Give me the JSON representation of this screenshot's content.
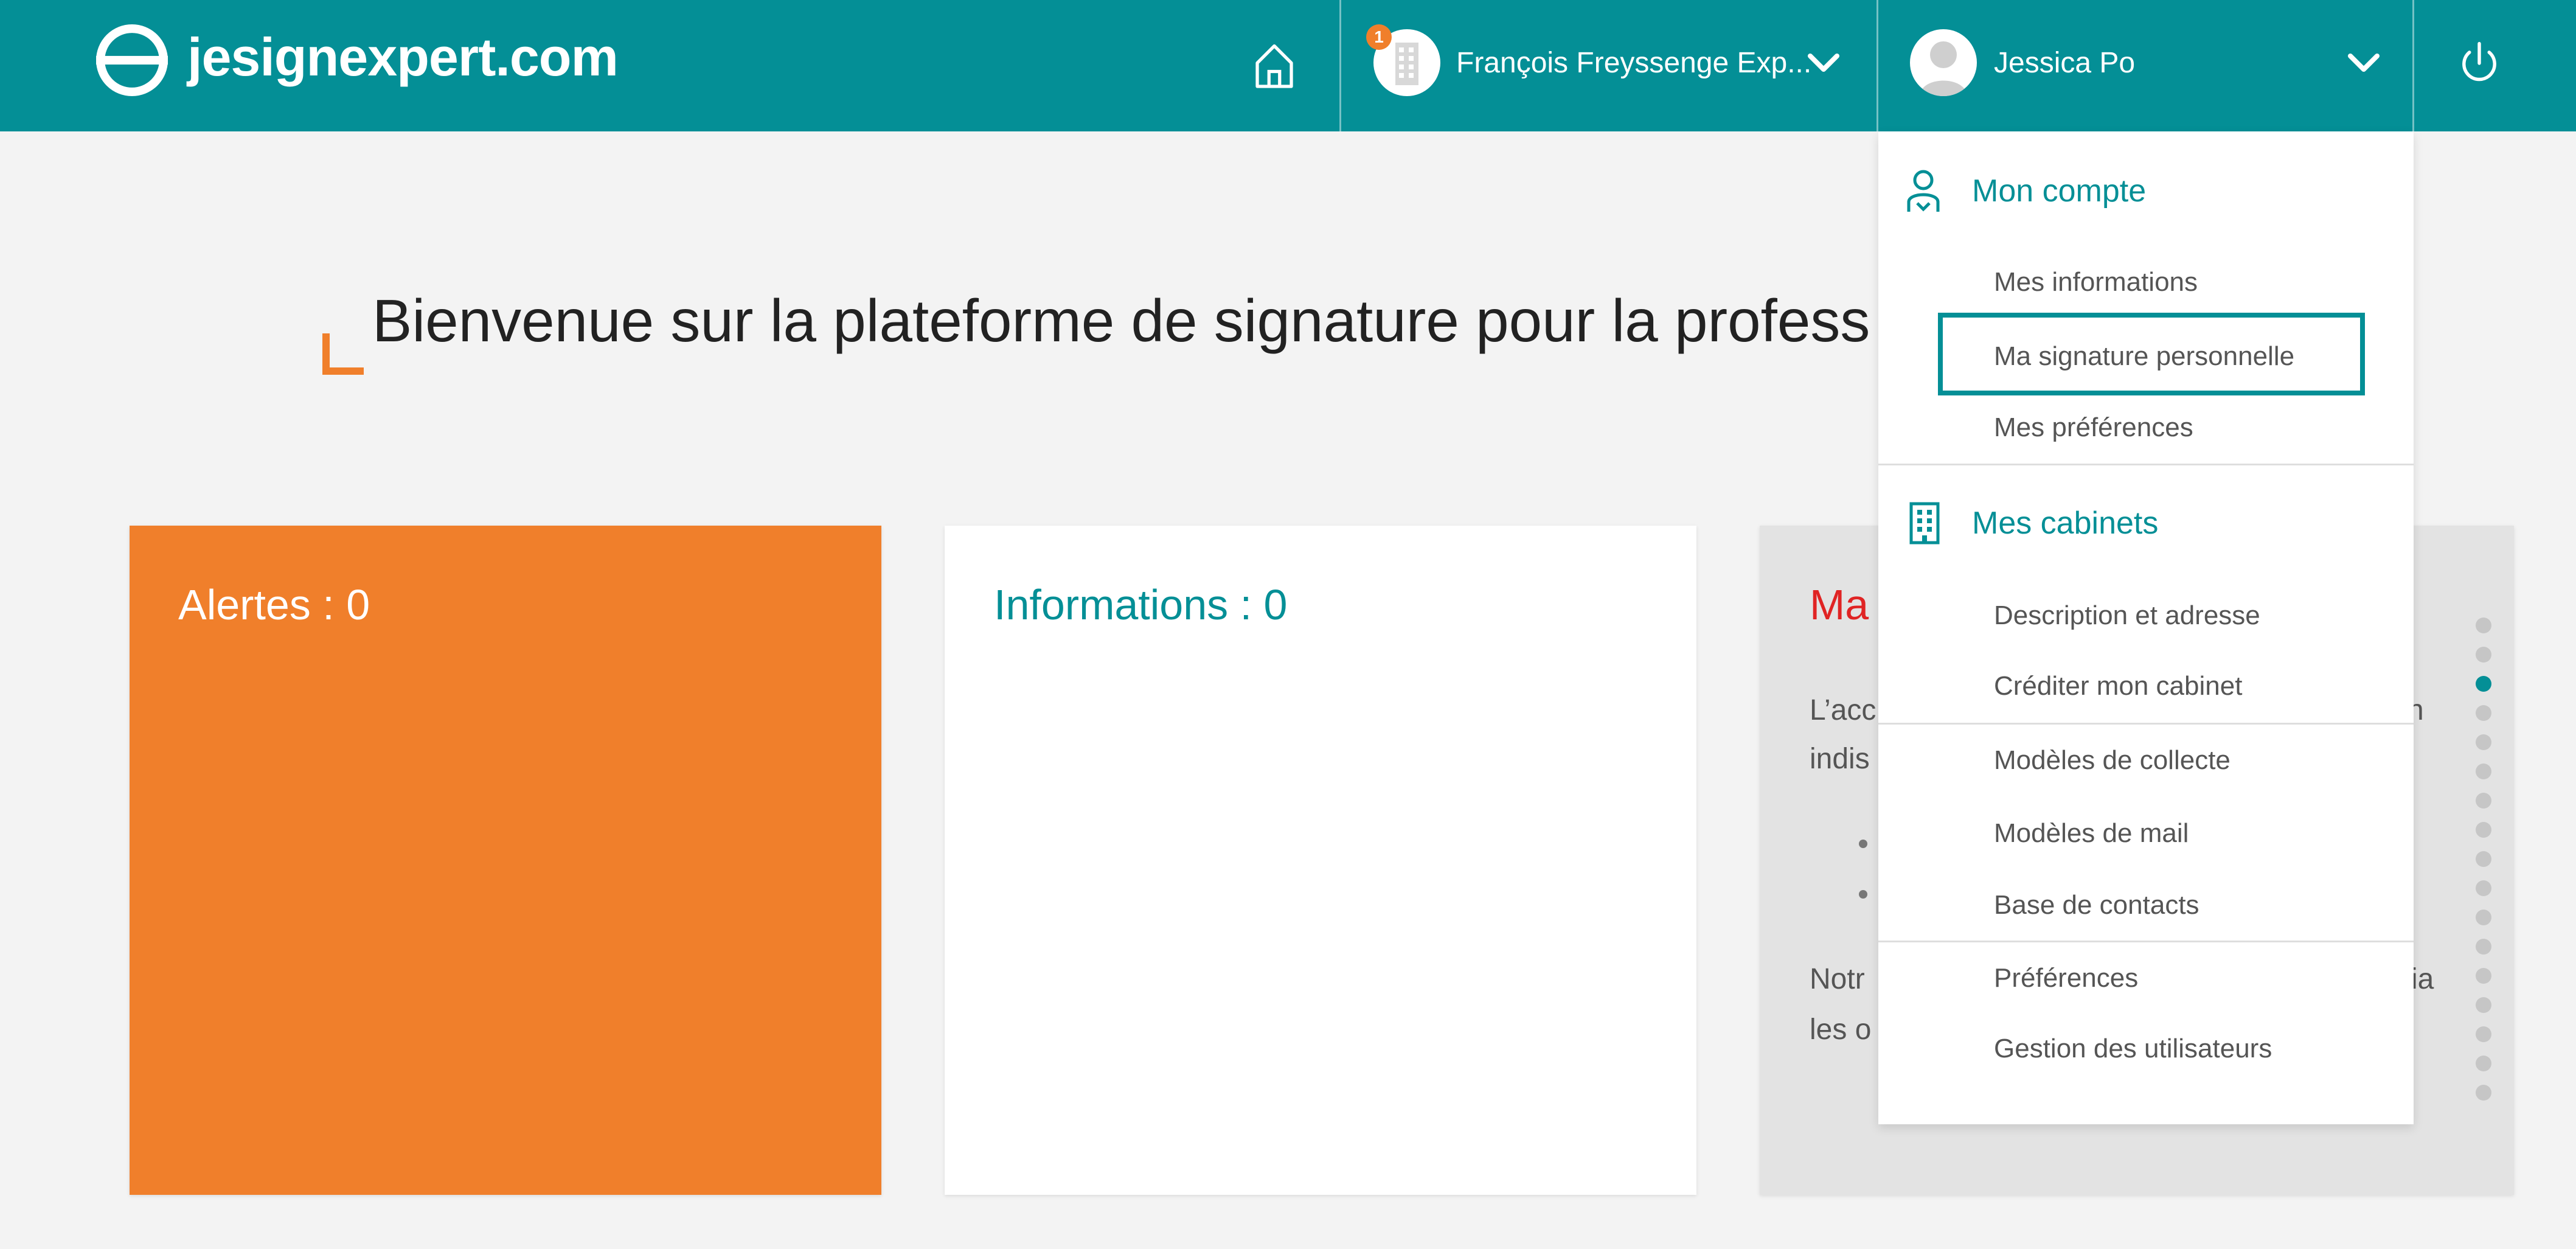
{
  "header": {
    "logo_text": "jesignexpert.com",
    "org": {
      "name": "François Freyssenge Exp...",
      "badge_count": "1"
    },
    "user": {
      "name": "Jessica Po"
    }
  },
  "welcome": {
    "title": "Bienvenue sur la plateforme de signature pour la profess"
  },
  "cards": {
    "alerts": {
      "title": "Alertes : 0"
    },
    "info": {
      "title": "Informations : 0"
    },
    "third": {
      "title": "Ma",
      "para1_line1": "L’acc",
      "para1_line2": "indis",
      "para1_right": "n",
      "para2_line1": "Notr",
      "para2_line2": "les o",
      "para2_right": "via",
      "pager_dots": 17,
      "pager_active_index": 2
    }
  },
  "dropdown": {
    "mon_compte": {
      "label": "Mon compte",
      "items": [
        "Mes informations",
        "Ma signature personnelle",
        "Mes préférences"
      ]
    },
    "mes_cabinets": {
      "label": "Mes cabinets",
      "items": [
        "Description et adresse",
        "Créditer mon cabinet",
        "Modèles de collecte",
        "Modèles de mail",
        "Base de contacts",
        "Préférences",
        "Gestion des utilisateurs"
      ]
    },
    "highlighted_item": "Ma signature personnelle"
  },
  "colors": {
    "brand_teal": "#048f96",
    "accent_orange": "#f07f2b",
    "title_red": "#e02424"
  },
  "icons": [
    "logo-icon",
    "home-icon",
    "building-icon",
    "chevron-down-icon",
    "user-avatar-icon",
    "power-icon",
    "account-icon"
  ]
}
